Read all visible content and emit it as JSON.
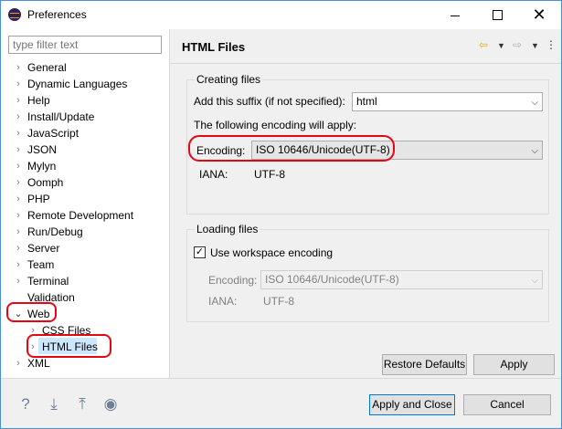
{
  "window": {
    "title": "Preferences",
    "controls": {
      "minimize": "minimize",
      "maximize": "maximize",
      "close": "✕"
    }
  },
  "sidebar": {
    "filter_placeholder": "type filter text",
    "items": [
      {
        "label": "General"
      },
      {
        "label": "Dynamic Languages"
      },
      {
        "label": "Help"
      },
      {
        "label": "Install/Update"
      },
      {
        "label": "JavaScript"
      },
      {
        "label": "JSON"
      },
      {
        "label": "Mylyn"
      },
      {
        "label": "Oomph"
      },
      {
        "label": "PHP"
      },
      {
        "label": "Remote Development"
      },
      {
        "label": "Run/Debug"
      },
      {
        "label": "Server"
      },
      {
        "label": "Team"
      },
      {
        "label": "Terminal"
      },
      {
        "label": "Validation"
      },
      {
        "label": "Web"
      },
      {
        "label": "CSS Files"
      },
      {
        "label": "HTML Files"
      },
      {
        "label": "XML"
      }
    ]
  },
  "main": {
    "title": "HTML Files",
    "creating": {
      "group_label": "Creating files",
      "suffix_label": "Add this suffix (if not specified):",
      "suffix_value": "html",
      "encoding_note": "The following encoding will apply:",
      "encoding_label": "Encoding:",
      "encoding_value": "ISO 10646/Unicode(UTF-8)",
      "iana_label": "IANA:",
      "iana_value": "UTF-8"
    },
    "loading": {
      "group_label": "Loading files",
      "use_workspace_label": "Use workspace encoding",
      "use_workspace_checked": true,
      "encoding_label": "Encoding:",
      "encoding_value": "ISO 10646/Unicode(UTF-8)",
      "iana_label": "IANA:",
      "iana_value": "UTF-8"
    },
    "restore_defaults": "Restore Defaults",
    "apply": "Apply"
  },
  "footer": {
    "apply_and_close": "Apply and Close",
    "cancel": "Cancel"
  },
  "colors": {
    "highlight": "#e30613",
    "selection": "#cce8ff",
    "primary_border": "#0078d7"
  }
}
